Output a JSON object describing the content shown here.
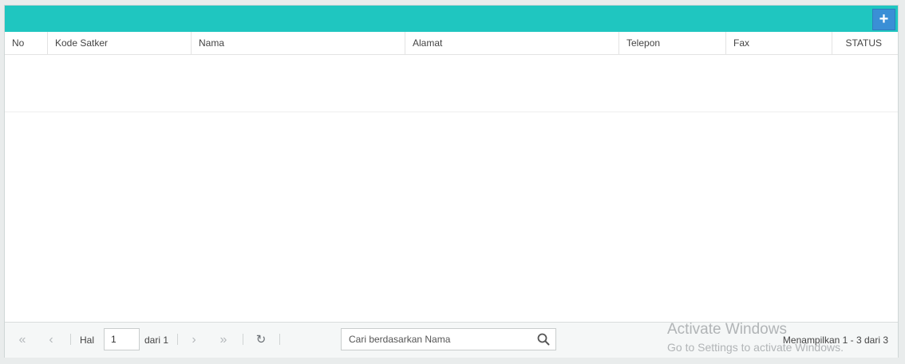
{
  "toolbar": {
    "add_label": "+"
  },
  "table": {
    "columns": [
      "No",
      "Kode Satker",
      "Nama",
      "Alamat",
      "Telepon",
      "Fax",
      "STATUS"
    ]
  },
  "pager": {
    "first": "«",
    "prev": "‹",
    "page_label": "Hal",
    "page_value": "1",
    "of_label": "dari 1",
    "next": "›",
    "last": "»",
    "refresh": "↻",
    "search_placeholder": "Cari berdasarkan Nama",
    "display_text": "Menampilkan 1 - 3 dari 3"
  },
  "watermark": {
    "line1": "Activate Windows",
    "line2": "Go to Settings to activate Windows."
  },
  "colors": {
    "header": "#1fc6c0",
    "add_button": "#3a8fd6"
  }
}
